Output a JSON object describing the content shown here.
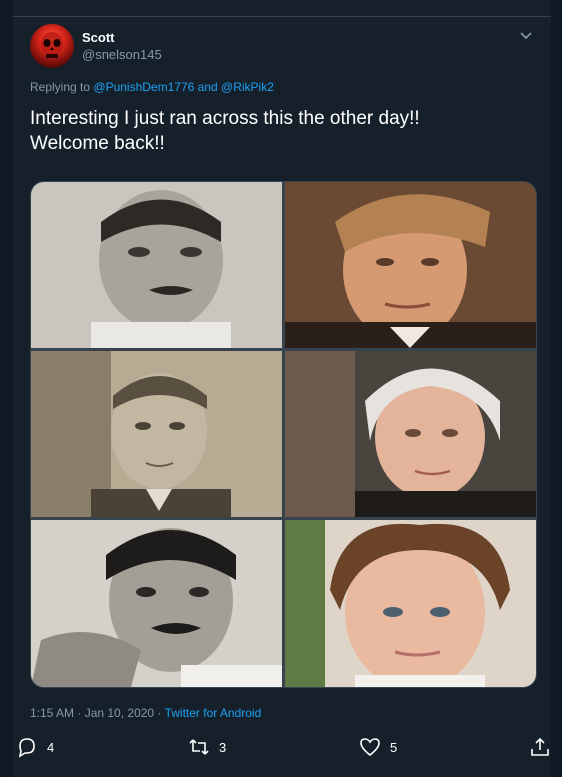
{
  "tweet": {
    "author": {
      "display_name": "Scott",
      "handle": "@snelson145",
      "avatar_icon": "red-skull-avatar"
    },
    "reply_to": {
      "prefix": "Replying to",
      "mention_1": "@PunishDem1776",
      "joiner": "and",
      "mention_2": "@RikPik2"
    },
    "text_line_1": "Interesting I just ran across this the other day!!",
    "text_line_2": "Welcome back!!",
    "media": {
      "photos": [
        {
          "name": "photo-1",
          "style": "sepia"
        },
        {
          "name": "photo-2",
          "style": "color"
        },
        {
          "name": "photo-3",
          "style": "sepia"
        },
        {
          "name": "photo-4",
          "style": "color"
        },
        {
          "name": "photo-5",
          "style": "sepia"
        },
        {
          "name": "photo-6",
          "style": "color"
        }
      ]
    },
    "time": "1:15 AM · Jan 10, 2020",
    "separator": "·",
    "source": "Twitter for Android",
    "actions": {
      "reply_count": "4",
      "retweet_count": "3",
      "like_count": "5"
    }
  },
  "colors": {
    "background": "#15202b",
    "text_primary": "#ffffff",
    "text_secondary": "#8899a6",
    "accent": "#1da1f2",
    "divider": "#38444d"
  }
}
